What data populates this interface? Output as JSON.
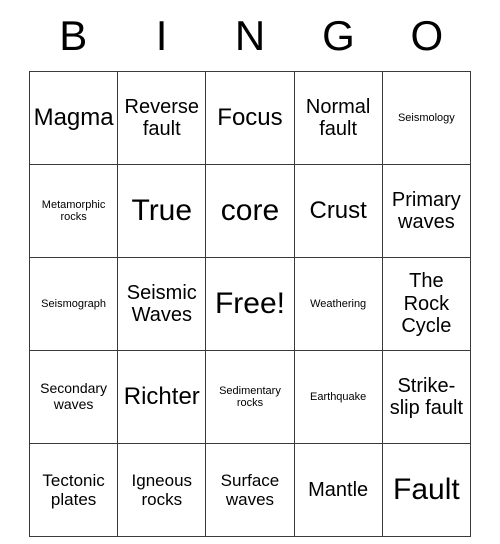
{
  "card": {
    "header_letters": [
      "B",
      "I",
      "N",
      "G",
      "O"
    ],
    "rows": [
      [
        {
          "text": "Magma",
          "size": "xl"
        },
        {
          "text": "Reverse fault",
          "size": "lg"
        },
        {
          "text": "Focus",
          "size": "xl"
        },
        {
          "text": "Normal fault",
          "size": "lg"
        },
        {
          "text": "Seismology",
          "size": "xs"
        }
      ],
      [
        {
          "text": "Metamorphic rocks",
          "size": "xs"
        },
        {
          "text": "True",
          "size": "xxl"
        },
        {
          "text": "core",
          "size": "xxl"
        },
        {
          "text": "Crust",
          "size": "xl"
        },
        {
          "text": "Primary waves",
          "size": "lg"
        }
      ],
      [
        {
          "text": "Seismograph",
          "size": "xs"
        },
        {
          "text": "Seismic Waves",
          "size": "lg"
        },
        {
          "text": "Free!",
          "size": "xxl"
        },
        {
          "text": "Weathering",
          "size": "xs"
        },
        {
          "text": "The Rock Cycle",
          "size": "lg"
        }
      ],
      [
        {
          "text": "Secondary waves",
          "size": "sm"
        },
        {
          "text": "Richter",
          "size": "xl"
        },
        {
          "text": "Sedimentary rocks",
          "size": "xs"
        },
        {
          "text": "Earthquake",
          "size": "xs"
        },
        {
          "text": "Strike-slip fault",
          "size": "lg"
        }
      ],
      [
        {
          "text": "Tectonic plates",
          "size": "md"
        },
        {
          "text": "Igneous rocks",
          "size": "md"
        },
        {
          "text": "Surface waves",
          "size": "md"
        },
        {
          "text": "Mantle",
          "size": "lg"
        },
        {
          "text": "Fault",
          "size": "xxl"
        }
      ]
    ]
  }
}
